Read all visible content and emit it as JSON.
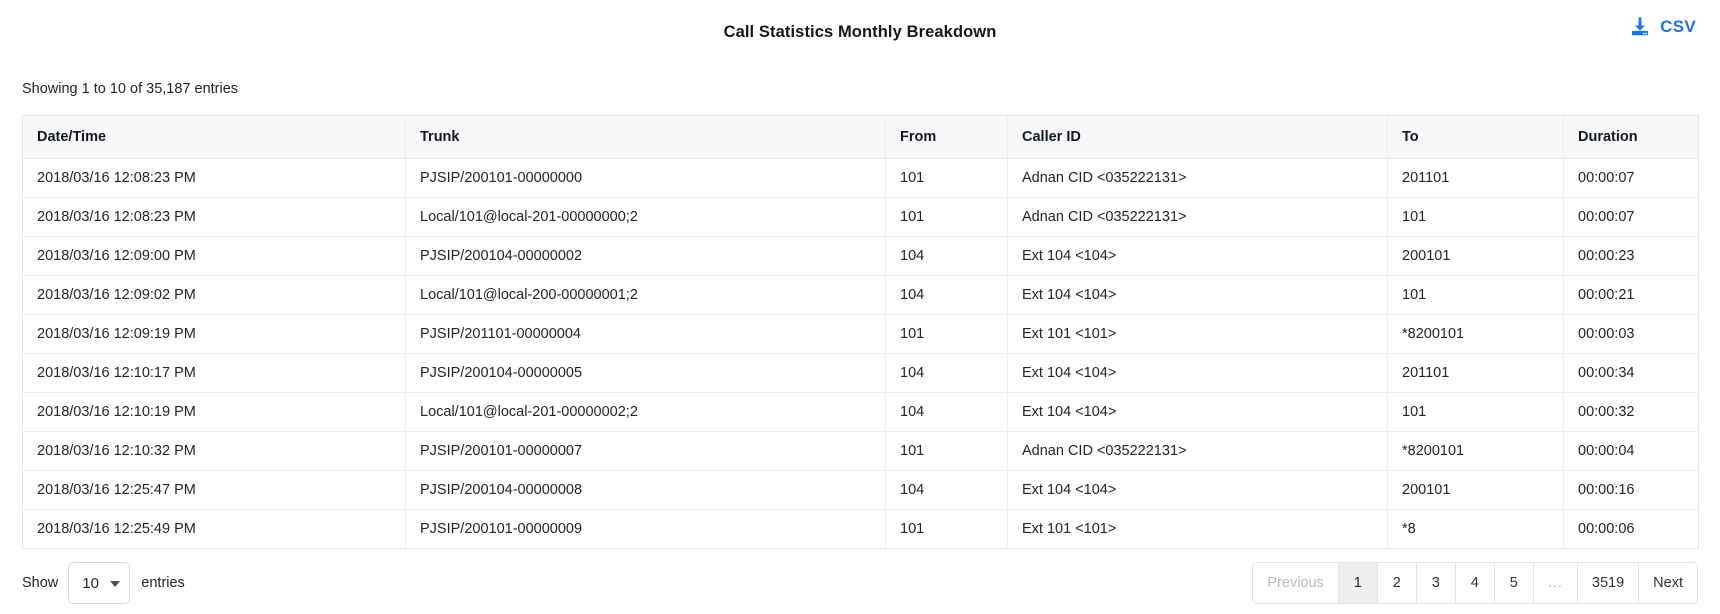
{
  "header": {
    "title": "Call Statistics Monthly Breakdown",
    "csv_label": "CSV",
    "csv_icon": "download-icon",
    "accent_color": "#2075d6"
  },
  "info": {
    "text": "Showing 1 to 10 of 35,187 entries"
  },
  "table": {
    "columns": [
      "Date/Time",
      "Trunk",
      "From",
      "Caller ID",
      "To",
      "Duration"
    ],
    "rows": [
      {
        "datetime": "2018/03/16 12:08:23 PM",
        "trunk": "PJSIP/200101-00000000",
        "from": "101",
        "caller_id": "Adnan CID <035222131>",
        "to": "201101",
        "duration": "00:00:07"
      },
      {
        "datetime": "2018/03/16 12:08:23 PM",
        "trunk": "Local/101@local-201-00000000;2",
        "from": "101",
        "caller_id": "Adnan CID <035222131>",
        "to": "101",
        "duration": "00:00:07"
      },
      {
        "datetime": "2018/03/16 12:09:00 PM",
        "trunk": "PJSIP/200104-00000002",
        "from": "104",
        "caller_id": "Ext 104 <104>",
        "to": "200101",
        "duration": "00:00:23"
      },
      {
        "datetime": "2018/03/16 12:09:02 PM",
        "trunk": "Local/101@local-200-00000001;2",
        "from": "104",
        "caller_id": "Ext 104 <104>",
        "to": "101",
        "duration": "00:00:21"
      },
      {
        "datetime": "2018/03/16 12:09:19 PM",
        "trunk": "PJSIP/201101-00000004",
        "from": "101",
        "caller_id": "Ext 101 <101>",
        "to": "*8200101",
        "duration": "00:00:03"
      },
      {
        "datetime": "2018/03/16 12:10:17 PM",
        "trunk": "PJSIP/200104-00000005",
        "from": "104",
        "caller_id": "Ext 104 <104>",
        "to": "201101",
        "duration": "00:00:34"
      },
      {
        "datetime": "2018/03/16 12:10:19 PM",
        "trunk": "Local/101@local-201-00000002;2",
        "from": "104",
        "caller_id": "Ext 104 <104>",
        "to": "101",
        "duration": "00:00:32"
      },
      {
        "datetime": "2018/03/16 12:10:32 PM",
        "trunk": "PJSIP/200101-00000007",
        "from": "101",
        "caller_id": "Adnan CID <035222131>",
        "to": "*8200101",
        "duration": "00:00:04"
      },
      {
        "datetime": "2018/03/16 12:25:47 PM",
        "trunk": "PJSIP/200104-00000008",
        "from": "104",
        "caller_id": "Ext 104 <104>",
        "to": "200101",
        "duration": "00:00:16"
      },
      {
        "datetime": "2018/03/16 12:25:49 PM",
        "trunk": "PJSIP/200101-00000009",
        "from": "101",
        "caller_id": "Ext 101 <101>",
        "to": "*8",
        "duration": "00:00:06"
      }
    ]
  },
  "footer": {
    "length": {
      "prefix": "Show",
      "value": "10",
      "suffix": "entries"
    },
    "pagination": {
      "previous_label": "Previous",
      "next_label": "Next",
      "ellipsis_label": "...",
      "pages": [
        "1",
        "2",
        "3",
        "4",
        "5"
      ],
      "last_page": "3519",
      "active_page": "1"
    }
  }
}
